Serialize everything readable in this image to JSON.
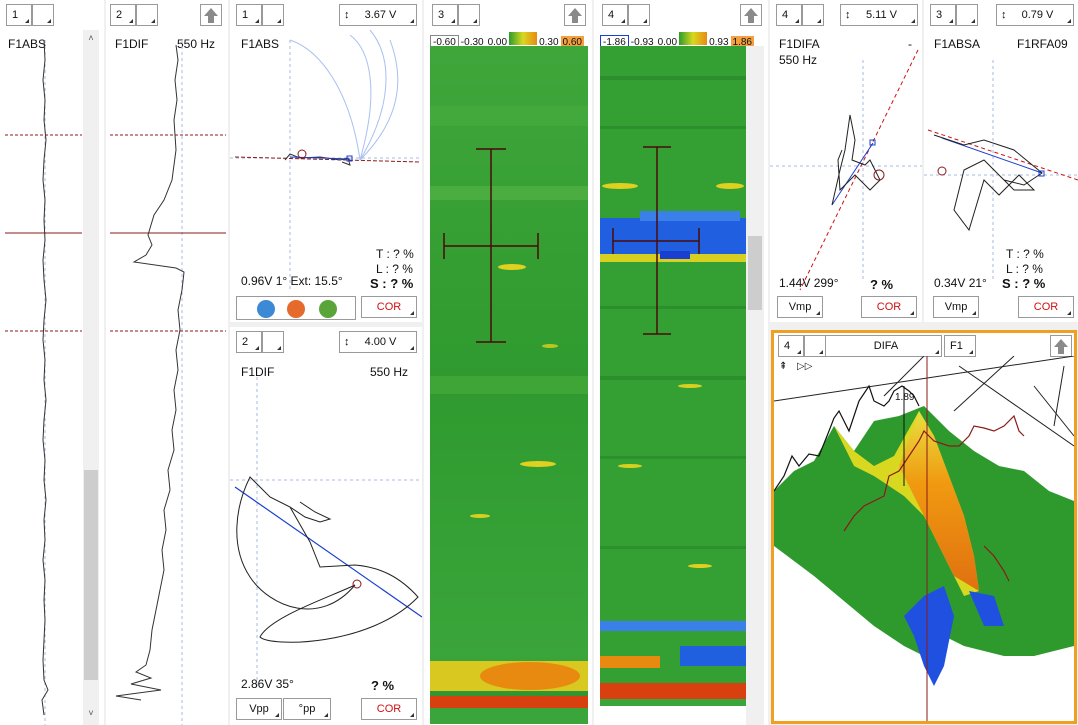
{
  "panel1": {
    "ch": "1",
    "label": "F1ABS"
  },
  "panel2": {
    "ch": "2",
    "label": "F1DIF",
    "freq": "550 Hz"
  },
  "panel3": {
    "ch": "1",
    "voltage": "3.67 V",
    "label": "F1ABS",
    "t_line": "T : ? %",
    "l_line": "L : ? %",
    "s_line": "S : ? %",
    "readout": "0.96V 1°  Ext: 15.5°",
    "cor": "COR"
  },
  "panel4": {
    "ch": "2",
    "voltage": "4.00 V",
    "label": "F1DIF",
    "freq": "550 Hz",
    "readout": "2.86V 35°",
    "pct": "? %",
    "btn_vpp": "Vpp",
    "btn_pp": "°pp",
    "cor": "COR"
  },
  "strip1": {
    "ch": "3",
    "colorbar": [
      "-0.60",
      "-0.30",
      "0.00",
      "0.30",
      "0.60"
    ]
  },
  "strip2": {
    "ch": "4",
    "colorbar": [
      "-1.86",
      "-0.93",
      "0.00",
      "0.93",
      "1.86"
    ]
  },
  "lissajous1": {
    "ch": "4",
    "voltage": "5.11 V",
    "label": "F1DIFA",
    "dash": "-",
    "freq": "550 Hz",
    "readout": "1.44V 299°",
    "pct": "? %",
    "btn_vmp": "Vmp",
    "cor": "COR"
  },
  "lissajous2": {
    "ch": "3",
    "voltage": "0.79 V",
    "label": "F1ABSA",
    "label2": "F1RFA09",
    "t_line": "T : ? %",
    "l_line": "L : ? %",
    "s_line": "S : ? %",
    "readout": "0.34V 21°",
    "btn_vmp": "Vmp",
    "cor": "COR"
  },
  "view3d": {
    "ch": "4",
    "title": "DIFA",
    "freq": "F1",
    "peak_label": "1.89"
  },
  "colors": {
    "accent": "#f0a020",
    "red": "#d01010",
    "blue": "#1a3fd0",
    "green": "#2a9e2a"
  }
}
